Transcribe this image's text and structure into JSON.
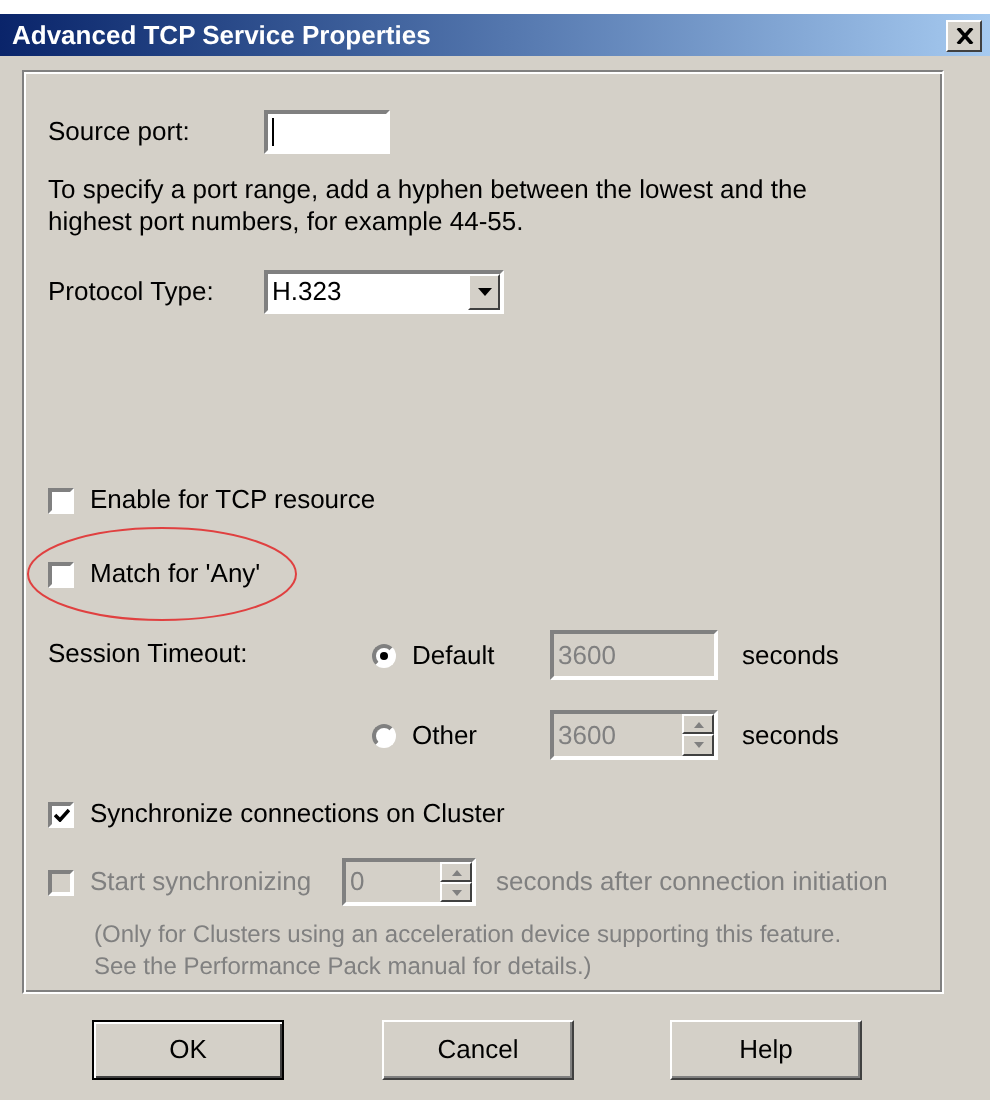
{
  "window": {
    "title": "Advanced TCP Service Properties"
  },
  "source_port": {
    "label": "Source port:",
    "focused": true
  },
  "hint": "To specify a port range, add a hyphen between the lowest and the highest port numbers, for example 44-55.",
  "protocol": {
    "label": "Protocol Type:",
    "value": "H.323"
  },
  "checkboxes": [
    {
      "label": "Enable for TCP resource",
      "checked": false,
      "highlighted": false
    },
    {
      "label": "Match for 'Any'",
      "checked": false,
      "highlighted": true
    }
  ],
  "session_timeout": {
    "label": "Session Timeout:",
    "options": [
      {
        "label": "Default",
        "selected": true,
        "kind": "field",
        "value": "3600",
        "disabled": true,
        "unit": "seconds"
      },
      {
        "label": "Other",
        "selected": false,
        "kind": "spinner",
        "value": "3600",
        "disabled": true,
        "unit": "seconds"
      }
    ]
  },
  "sync": {
    "label": "Synchronize connections on Cluster",
    "checked": true
  },
  "start_sync": {
    "label": "Start synchronizing",
    "checked": false,
    "disabled": true,
    "value": "0",
    "suffix": "seconds after connection initiation"
  },
  "note_lines": [
    "(Only for Clusters using an acceleration device supporting this feature.",
    "See the Performance Pack manual for details.)"
  ],
  "buttons": [
    {
      "label": "OK",
      "default": true
    },
    {
      "label": "Cancel",
      "default": false
    },
    {
      "label": "Help",
      "default": false
    }
  ]
}
